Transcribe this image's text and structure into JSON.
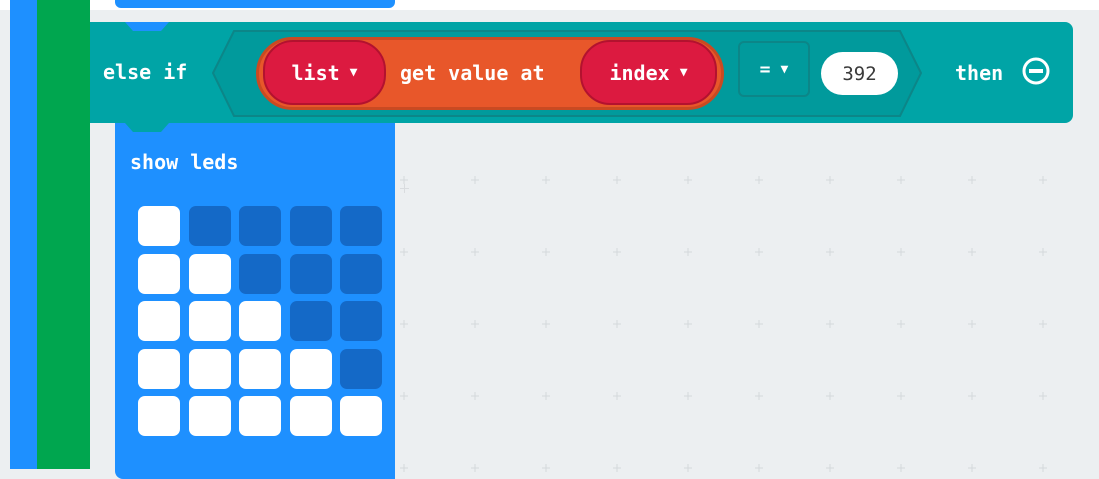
{
  "else_if_block": {
    "else_if_label": "else if",
    "then_label": "then",
    "list_dropdown": "list",
    "get_value_at_label": "get value at",
    "index_dropdown": "index",
    "operator": "=",
    "compare_value": "392",
    "block_color": "#00a4a6",
    "get_value_color": "#e8572a",
    "variable_color": "#dc1a40",
    "remove_icon": "minus-circle-icon"
  },
  "show_leds_block": {
    "label": "show leds",
    "block_color": "#1e90ff",
    "led_on_color": "#ffffff",
    "led_off_color": "#1469c7",
    "grid": [
      [
        1,
        0,
        0,
        0,
        0
      ],
      [
        1,
        1,
        0,
        0,
        0
      ],
      [
        1,
        1,
        1,
        0,
        0
      ],
      [
        1,
        1,
        1,
        1,
        0
      ],
      [
        1,
        1,
        1,
        1,
        1
      ]
    ]
  },
  "left_bars": {
    "outer_color": "#1e90ff",
    "inner_color": "#00a64f"
  },
  "icons": {
    "dropdown": "caret-down-icon"
  }
}
